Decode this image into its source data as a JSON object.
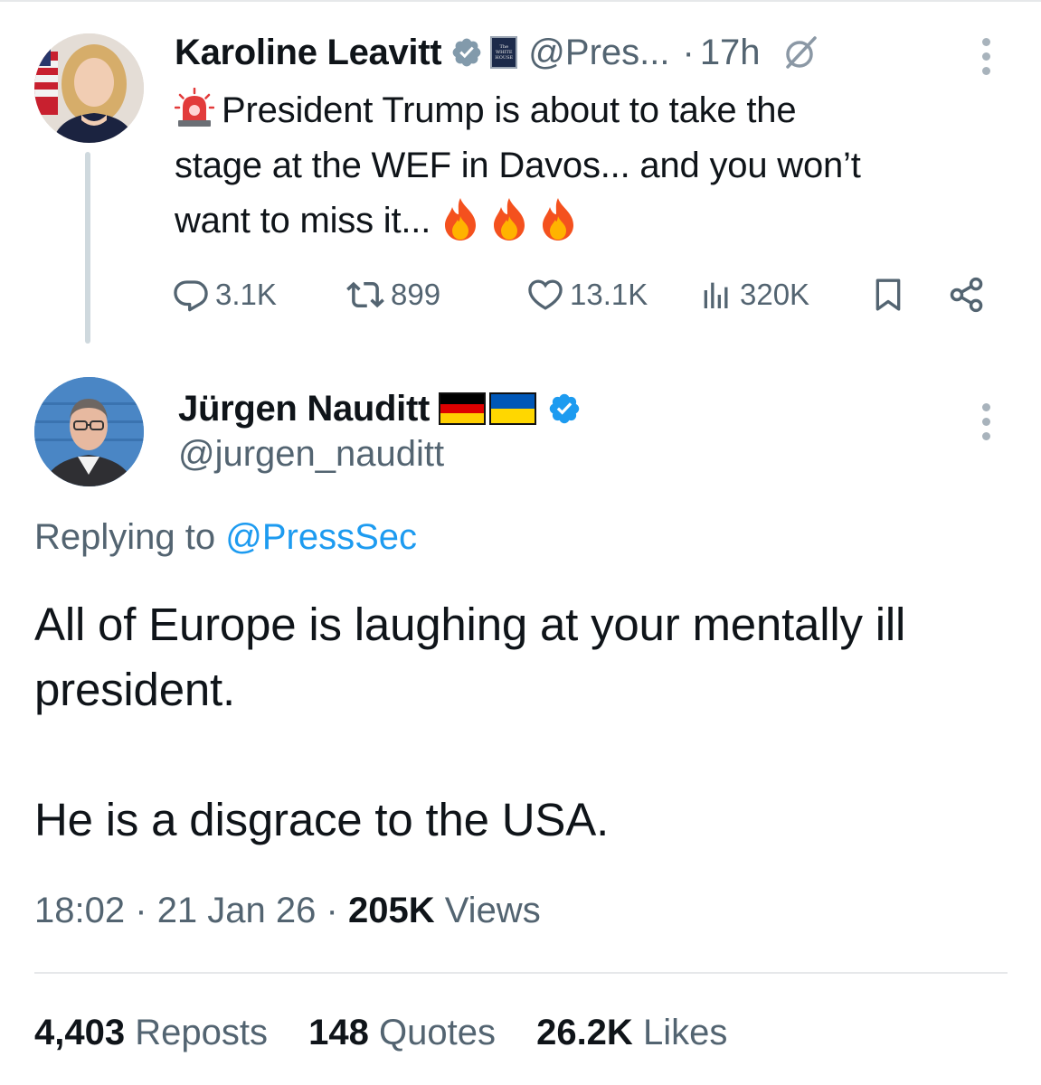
{
  "parent_tweet": {
    "author_name": "Karoline Leavitt",
    "handle": "@Pres...",
    "separator": "·",
    "time": "17h",
    "gov_badge_text": [
      "The",
      "WHITE",
      "HOUSE"
    ],
    "text_lines": [
      "President Trump is about to take the",
      "stage at the WEF in Davos... and you won’t",
      "want to miss it..."
    ],
    "icons": {
      "lead": "rotating-light-emoji",
      "trail": [
        "fire-emoji",
        "fire-emoji",
        "fire-emoji"
      ]
    },
    "actions": {
      "replies": "3.1K",
      "reposts": "899",
      "likes": "13.1K",
      "views": "320K"
    }
  },
  "main_tweet": {
    "author_name": "Jürgen Nauditt",
    "flags": [
      "germany-flag",
      "ukraine-flag"
    ],
    "handle": "@jurgen_nauditt",
    "replying_prefix": "Replying to",
    "replying_to": "@PressSec",
    "paragraphs": [
      "All of Europe is laughing at your mentally ill president.",
      "He is a disgrace to the USA."
    ],
    "time": "18:02",
    "date": "21 Jan 26",
    "separator": "·",
    "views_count": "205K",
    "views_label": "Views",
    "stats": {
      "reposts_count": "4,403",
      "reposts_label": "Reposts",
      "quotes_count": "148",
      "quotes_label": "Quotes",
      "likes_count": "26.2K",
      "likes_label": "Likes"
    }
  },
  "colors": {
    "text": "#0f1419",
    "secondary": "#536471",
    "link": "#1d9bf0",
    "verified_blue": "#1d9bf0",
    "verified_gray": "#829aab",
    "divider": "#e6e8ea",
    "thread_line": "#cfd9de"
  }
}
